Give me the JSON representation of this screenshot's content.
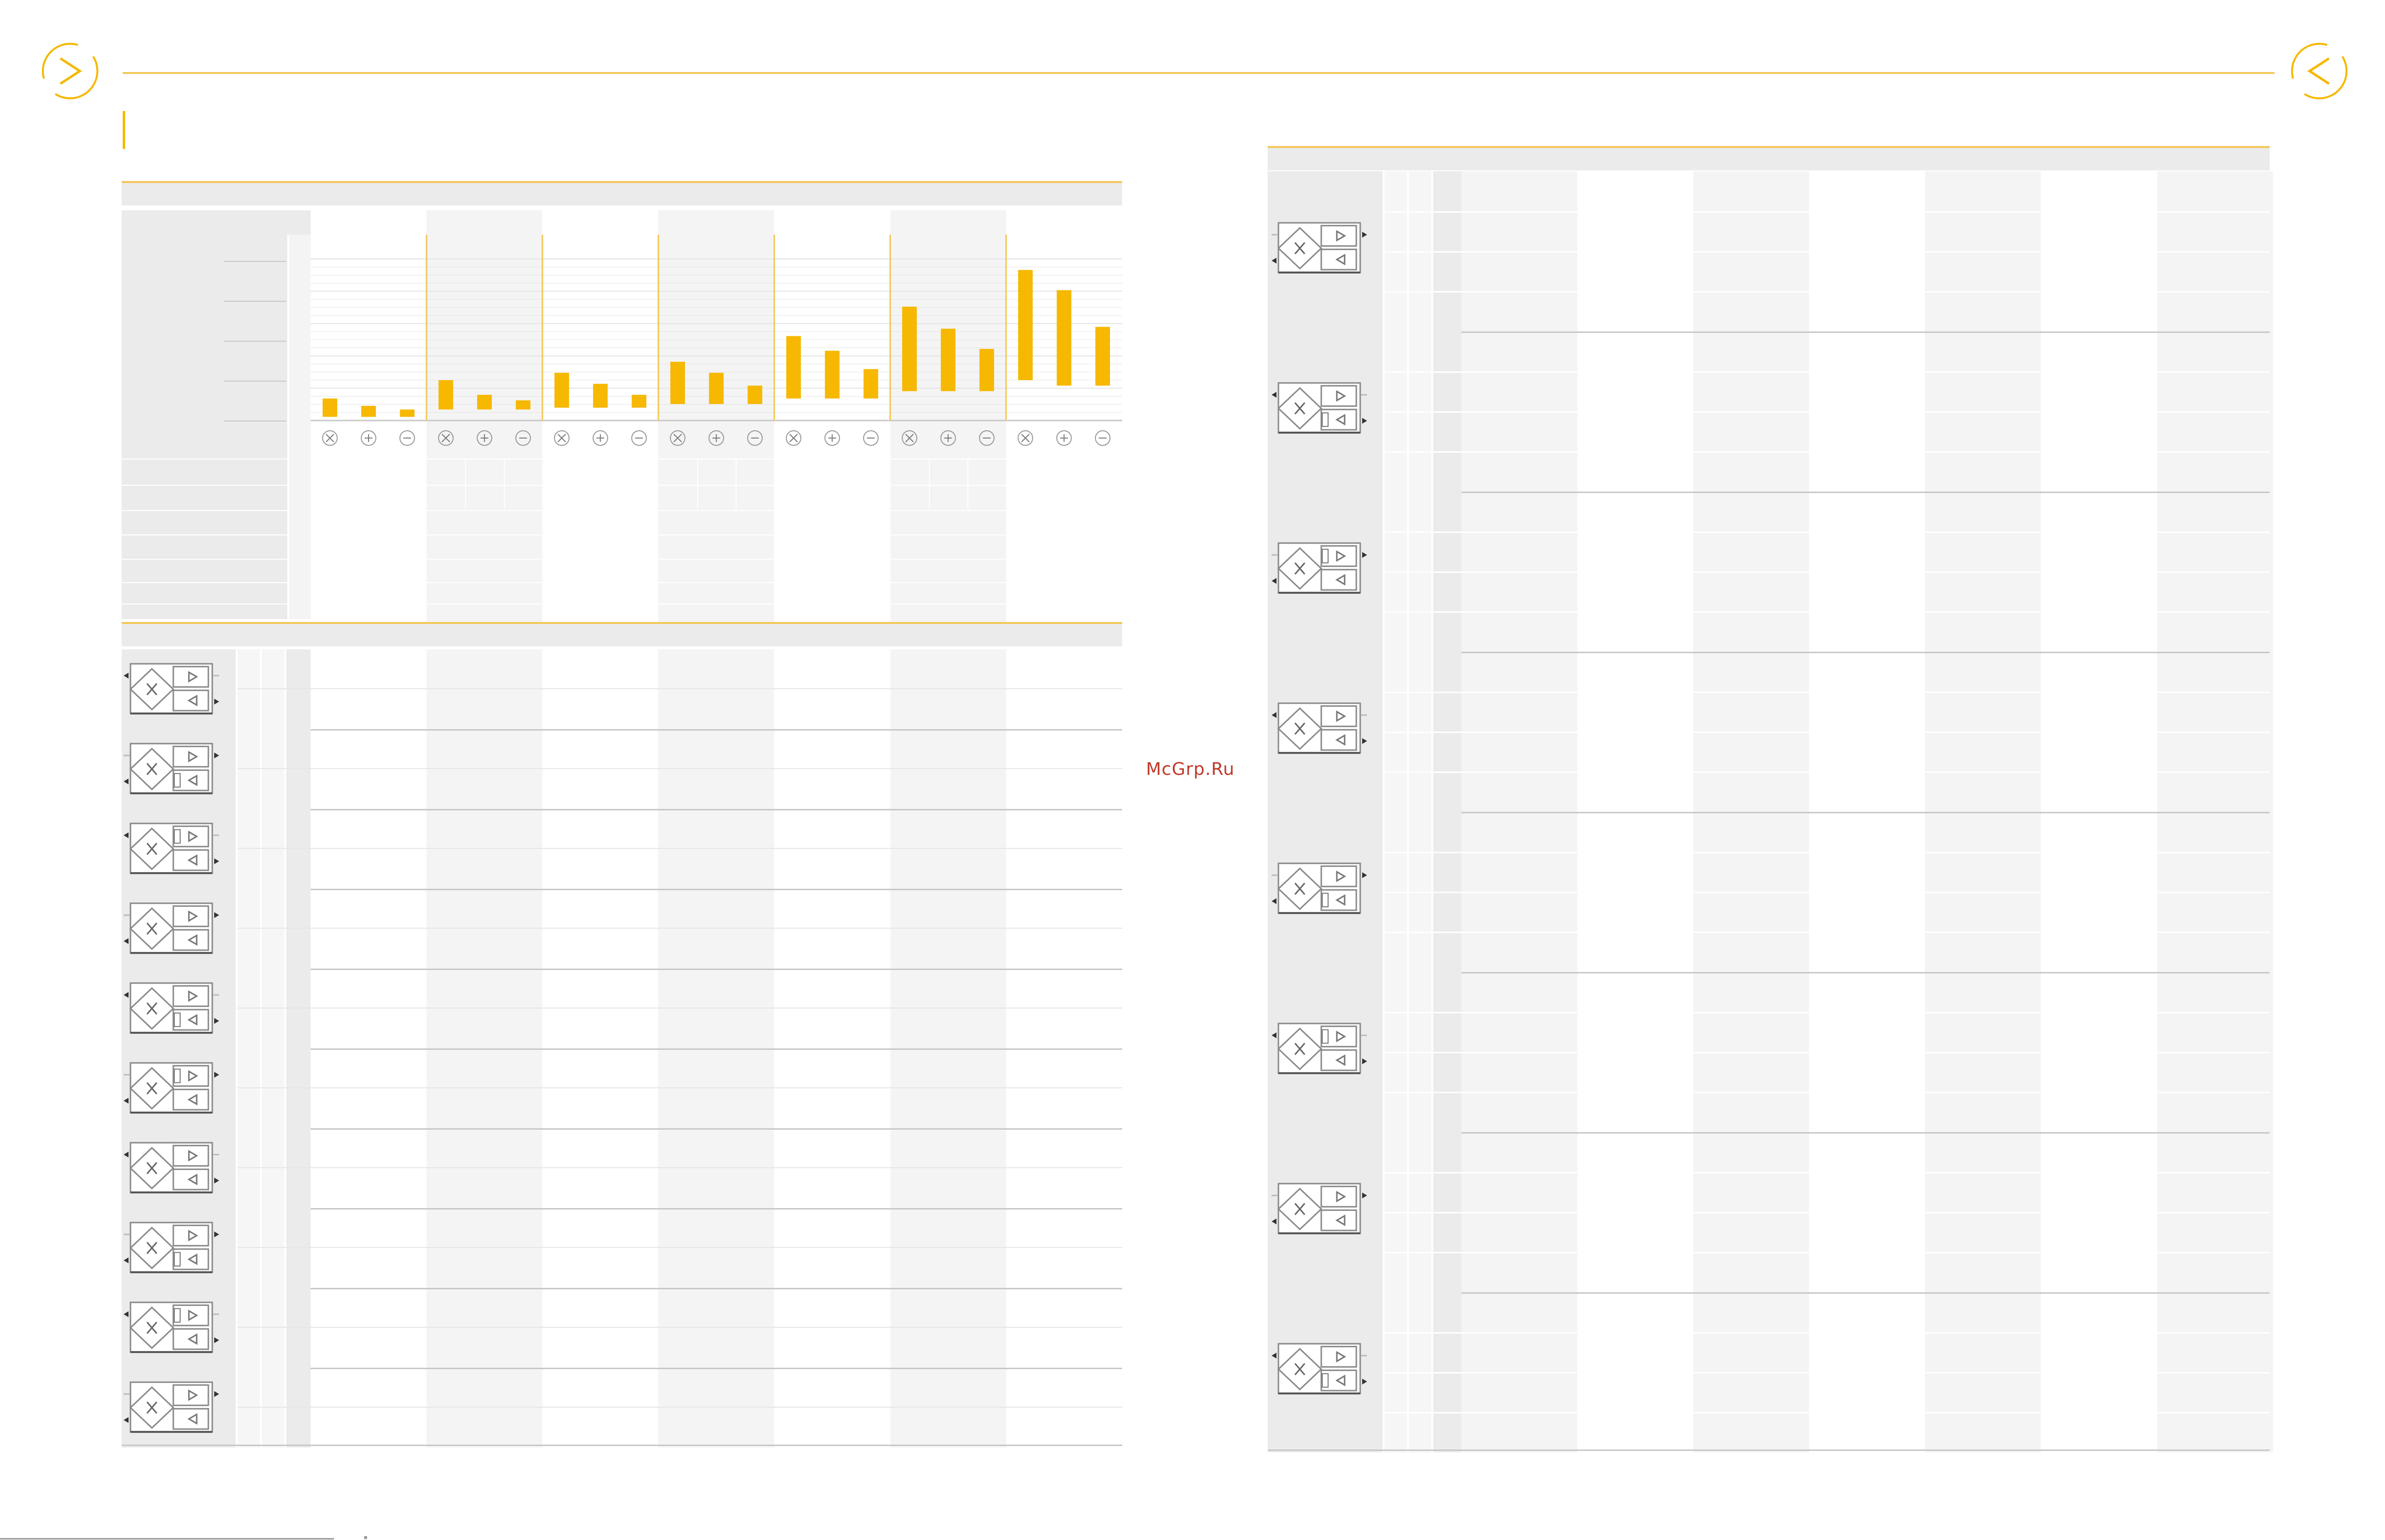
{
  "watermark": {
    "text": "McGrp.Ru"
  },
  "colors": {
    "accent": "#f6b800",
    "rule": "#f3c75a",
    "shade": "#ebebeb",
    "tint": "#f4f4f4",
    "divider": "#c8c8c8"
  },
  "nav": {
    "prev_icon": "chevron-left-circle",
    "next_icon": "chevron-right-circle"
  },
  "chart_data": {
    "type": "bar",
    "title": "",
    "xlabel": "",
    "ylabel": "",
    "ylim": [
      0,
      4.4
    ],
    "grid": true,
    "groups": 7,
    "marker_icons": [
      "cross-circle",
      "plus-circle",
      "minus-circle"
    ],
    "bars": [
      {
        "group": 1,
        "marker": "cross-circle",
        "low": 0.1,
        "high": 0.6
      },
      {
        "group": 1,
        "marker": "plus-circle",
        "low": 0.1,
        "high": 0.4
      },
      {
        "group": 1,
        "marker": "minus-circle",
        "low": 0.1,
        "high": 0.3
      },
      {
        "group": 2,
        "marker": "cross-circle",
        "low": 0.3,
        "high": 1.1
      },
      {
        "group": 2,
        "marker": "plus-circle",
        "low": 0.3,
        "high": 0.7
      },
      {
        "group": 2,
        "marker": "minus-circle",
        "low": 0.3,
        "high": 0.55
      },
      {
        "group": 3,
        "marker": "cross-circle",
        "low": 0.35,
        "high": 1.3
      },
      {
        "group": 3,
        "marker": "plus-circle",
        "low": 0.35,
        "high": 1.0
      },
      {
        "group": 3,
        "marker": "minus-circle",
        "low": 0.35,
        "high": 0.7
      },
      {
        "group": 4,
        "marker": "cross-circle",
        "low": 0.45,
        "high": 1.6
      },
      {
        "group": 4,
        "marker": "plus-circle",
        "low": 0.45,
        "high": 1.3
      },
      {
        "group": 4,
        "marker": "minus-circle",
        "low": 0.45,
        "high": 0.95
      },
      {
        "group": 5,
        "marker": "cross-circle",
        "low": 0.6,
        "high": 2.3
      },
      {
        "group": 5,
        "marker": "plus-circle",
        "low": 0.6,
        "high": 1.9
      },
      {
        "group": 5,
        "marker": "minus-circle",
        "low": 0.6,
        "high": 1.4
      },
      {
        "group": 6,
        "marker": "cross-circle",
        "low": 0.8,
        "high": 3.1
      },
      {
        "group": 6,
        "marker": "plus-circle",
        "low": 0.8,
        "high": 2.5
      },
      {
        "group": 6,
        "marker": "minus-circle",
        "low": 0.8,
        "high": 1.95
      },
      {
        "group": 7,
        "marker": "cross-circle",
        "low": 1.1,
        "high": 4.1
      },
      {
        "group": 7,
        "marker": "plus-circle",
        "low": 0.95,
        "high": 3.55
      },
      {
        "group": 7,
        "marker": "minus-circle",
        "low": 0.95,
        "high": 2.55
      }
    ]
  },
  "left_table": {
    "unit_icons": [
      "unit-config-1",
      "unit-config-2",
      "unit-config-3",
      "unit-config-4",
      "unit-config-5",
      "unit-config-6",
      "unit-config-7",
      "unit-config-8",
      "unit-config-9",
      "unit-config-10"
    ]
  },
  "right_table": {
    "unit_icons": [
      "unit-config-11",
      "unit-config-12",
      "unit-config-13",
      "unit-config-14",
      "unit-config-15",
      "unit-config-16",
      "unit-config-17",
      "unit-config-18"
    ]
  }
}
